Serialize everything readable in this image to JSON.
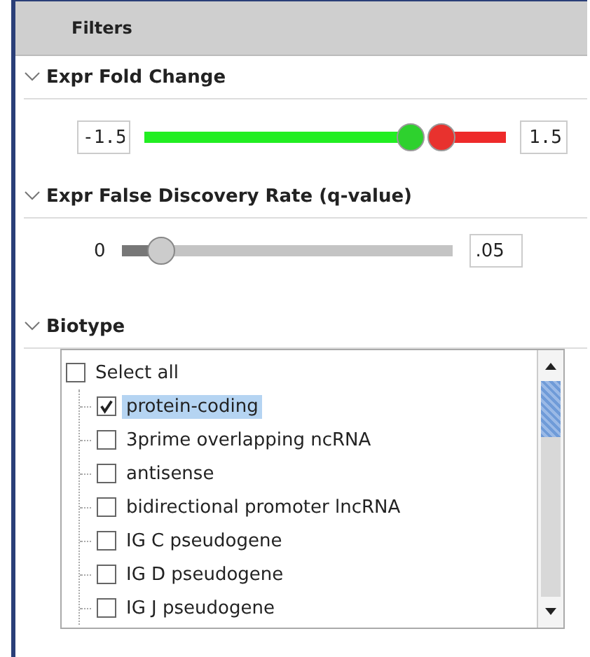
{
  "panel": {
    "title": "Filters"
  },
  "fold_change": {
    "title": "Expr Fold Change",
    "expanded": true,
    "min_value": "-1.5",
    "max_value": "1.5",
    "thumbs": [
      {
        "level": 0.75,
        "color": "#2ed12e"
      },
      {
        "level": 0.845,
        "color": "#e8322e"
      }
    ]
  },
  "fdr": {
    "title": "Expr False Discovery Rate (q-value)",
    "expanded": true,
    "min_label": "0",
    "max_value": ".05",
    "level": 0.09
  },
  "biotype": {
    "title": "Biotype",
    "expanded": true,
    "items": [
      {
        "label": "Select all",
        "checked": false,
        "selected": false,
        "children": [
          {
            "label": "protein-coding",
            "checked": true,
            "selected": true
          },
          {
            "label": "3prime overlapping ncRNA",
            "checked": false,
            "selected": false
          },
          {
            "label": "antisense",
            "checked": false,
            "selected": false
          },
          {
            "label": "bidirectional promoter lncRNA",
            "checked": false,
            "selected": false
          },
          {
            "label": "IG C pseudogene",
            "checked": false,
            "selected": false
          },
          {
            "label": "IG D pseudogene",
            "checked": false,
            "selected": false
          },
          {
            "label": "IG J pseudogene",
            "checked": false,
            "selected": false
          }
        ]
      }
    ]
  }
}
